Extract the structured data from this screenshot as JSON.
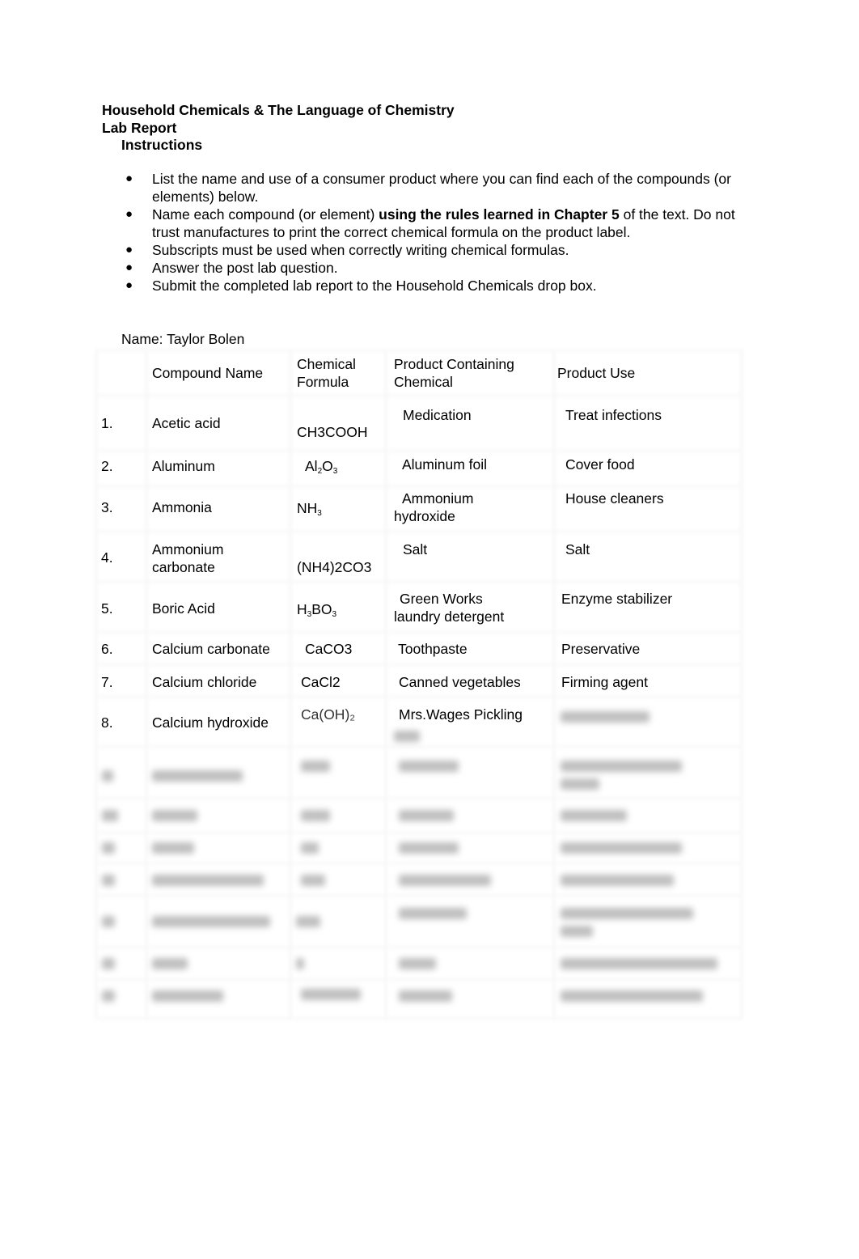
{
  "document": {
    "title": "Household Chemicals & The Language of Chemistry",
    "subtitle": "Lab Report",
    "instructions_heading": "Instructions",
    "bullet_glyph": "●",
    "instructions": [
      {
        "text": "List the name and use of a consumer product where you can find each of the compounds (or elements) below."
      },
      {
        "pre": "Name each compound (or element) ",
        "bold": "using the rules learned in Chapter 5",
        "post": " of the text. Do not trust manufactures to print the correct chemical formula on the product label."
      },
      {
        "text": "Subscripts must be used when correctly writing chemical formulas."
      },
      {
        "text": "Answer the post lab question."
      },
      {
        "text": "Submit the completed lab report to the Household Chemicals drop box."
      }
    ],
    "name_line": "Name: Taylor Bolen"
  },
  "table": {
    "headers": {
      "compound_name": "Compound Name",
      "chemical_formula_l1": "Chemical",
      "chemical_formula_l2": "Formula",
      "product_l1": "Product Containing",
      "product_l2": "Chemical",
      "use": "Product Use"
    },
    "rows": [
      {
        "num": "1.",
        "name": "Acetic acid",
        "formula": "CH3COOH",
        "product": "Medication",
        "use": "Treat infections"
      },
      {
        "num": "2.",
        "name": "Aluminum",
        "formula_parts": [
          "Al",
          "2",
          "O",
          "3"
        ],
        "product": "Aluminum foil",
        "use": "Cover food"
      },
      {
        "num": "3.",
        "name": "Ammonia",
        "formula_parts": [
          "NH",
          "3"
        ],
        "product_l1": "Ammonium",
        "product_l2": "hydroxide",
        "use": "House cleaners"
      },
      {
        "num": "4.",
        "name_l1": "Ammonium",
        "name_l2": "carbonate",
        "formula": "(NH4)2CO3",
        "product": "Salt",
        "use": "Salt"
      },
      {
        "num": "5.",
        "name": "Boric Acid",
        "formula_parts": [
          "H",
          "3",
          "BO",
          "3"
        ],
        "product_l1": "Green Works",
        "product_l2": "laundry detergent",
        "use": "Enzyme stabilizer"
      },
      {
        "num": "6.",
        "name": "Calcium carbonate",
        "formula": "CaCO3",
        "product": "Toothpaste",
        "use": "Preservative"
      },
      {
        "num": "7.",
        "name": "Calcium chloride",
        "formula": "CaCl2",
        "product": "Canned vegetables",
        "use": "Firming agent"
      },
      {
        "num": "8.",
        "name": "Calcium hydroxide",
        "formula": "Ca(OH)₂",
        "product": "Mrs.Wages Pickling",
        "use": "[blurred]"
      }
    ],
    "blurred_rows_count": 7
  }
}
